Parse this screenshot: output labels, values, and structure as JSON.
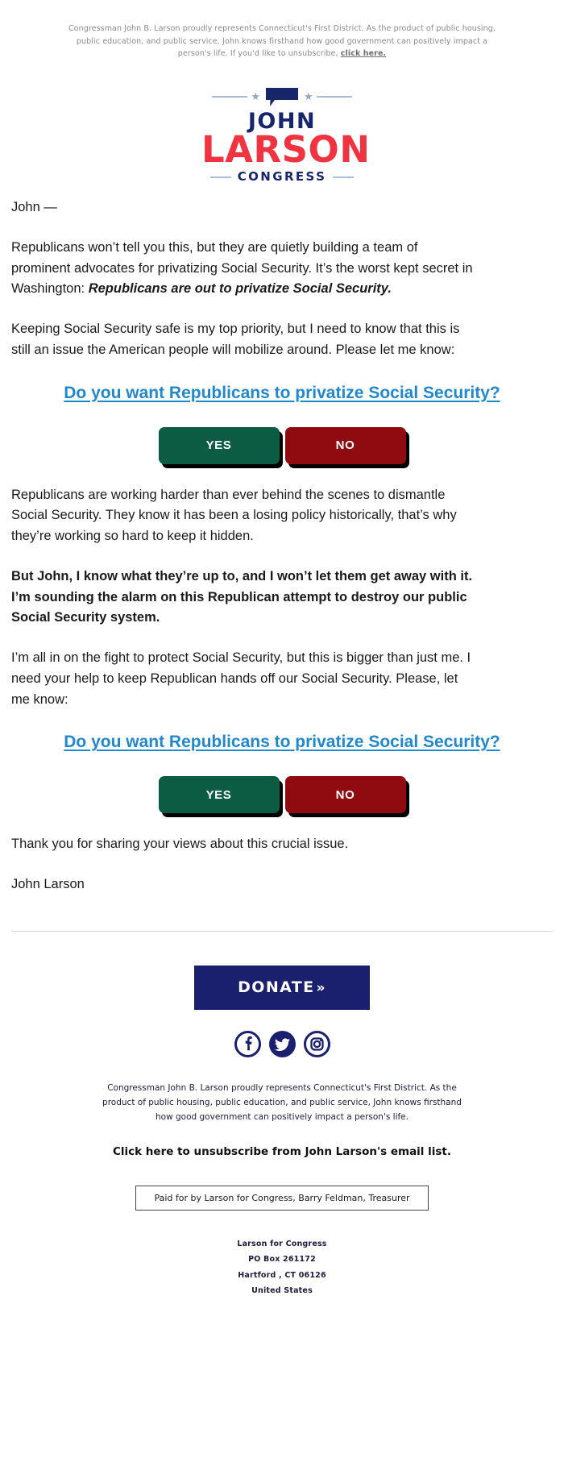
{
  "preheader": {
    "text": "Congressman John B. Larson proudly represents Connecticut's First District. As the product of public housing, public education, and public service, John knows firsthand how good government can positively impact a person's life. If you'd like to unsubscribe, ",
    "link_label": "click here."
  },
  "logo": {
    "first_name": "JOHN",
    "last_name": "LARSON",
    "office": "CONGRESS",
    "star_glyph": "★",
    "navy": "#17256b",
    "red": "#ef3340",
    "rule_color": "#a9bdd6"
  },
  "body": {
    "salutation": "John —",
    "paragraph_1": "Republicans won’t tell you this, but they are quietly building a team of prominent advocates for privatizing Social Security. It’s the worst kept secret in Washington: ",
    "paragraph_1_emphasis": "Republicans are out to privatize Social Security.",
    "paragraph_2": "Keeping Social Security safe is my top priority, but I need to know that this is still an issue the American people will mobilize around. Please let me know:",
    "paragraph_3": "Republicans are working harder than ever behind the scenes to dismantle Social Security. They know it has been a losing policy historically, that’s why they’re working so hard to keep it hidden.",
    "paragraph_4_bold": "But John, I know what they’re up to, and I won’t let them get away with it. I’m sounding the alarm on this Republican attempt to destroy our public Social Security system.",
    "paragraph_5": "I’m all in on the fight to protect Social Security, but this is bigger than just me. I need your help to keep Republican hands off our Social Security. Please, let me know:",
    "closing": "Thank you for sharing your views about this crucial issue.",
    "signature": "John Larson"
  },
  "cta": {
    "question": "Do you want Republicans to privatize Social Security?",
    "yes_label": "YES",
    "no_label": "NO",
    "yes_color": "#0b5c42",
    "no_color": "#8f0b10",
    "link_color": "#2288cc"
  },
  "footer": {
    "donate_label": "DONATE",
    "donate_chevron": "»",
    "donate_color": "#1a1f6e",
    "social": [
      {
        "name": "facebook-icon",
        "label": "Facebook"
      },
      {
        "name": "twitter-icon",
        "label": "Twitter"
      },
      {
        "name": "instagram-icon",
        "label": "Instagram"
      }
    ],
    "blurb": "Congressman John B. Larson proudly represents Connecticut's First District. As the product of public housing, public education, and public service, John knows firsthand how good government can positively impact a person's life.",
    "unsubscribe": "Click here to unsubscribe from John Larson's email list.",
    "paid_for": "Paid for by Larson for Congress, Barry Feldman, Treasurer",
    "address": {
      "line1": "Larson for Congress",
      "line2": "PO Box 261172",
      "line3": "Hartford , CT 06126",
      "line4": "United States"
    }
  }
}
